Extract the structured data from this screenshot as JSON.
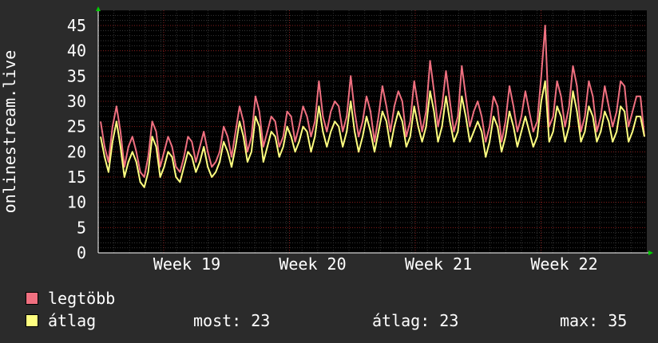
{
  "chart_data": {
    "type": "line",
    "ylabel": "onlinestream.live",
    "ylim": [
      0,
      48
    ],
    "yticks": [
      0,
      5,
      10,
      15,
      20,
      25,
      30,
      35,
      40,
      45
    ],
    "xticks": [
      "Week 19",
      "Week 20",
      "Week 21",
      "Week 22"
    ],
    "grid": true,
    "legend_placement": "bottom-left",
    "series": [
      {
        "name": "legtöbb",
        "color": "#f07080",
        "values": [
          26,
          21,
          18,
          25,
          29,
          24,
          17,
          21,
          23,
          20,
          16,
          15,
          19,
          26,
          24,
          17,
          20,
          23,
          21,
          17,
          16,
          19,
          23,
          22,
          18,
          21,
          24,
          20,
          17,
          18,
          20,
          25,
          23,
          19,
          24,
          29,
          26,
          20,
          23,
          31,
          28,
          21,
          24,
          27,
          26,
          21,
          23,
          28,
          27,
          22,
          25,
          29,
          27,
          23,
          26,
          34,
          27,
          24,
          28,
          30,
          29,
          24,
          27,
          35,
          28,
          23,
          26,
          31,
          28,
          22,
          27,
          33,
          29,
          24,
          29,
          32,
          30,
          23,
          26,
          34,
          29,
          24,
          28,
          38,
          32,
          25,
          29,
          36,
          30,
          24,
          27,
          37,
          31,
          25,
          28,
          30,
          27,
          22,
          25,
          31,
          29,
          22,
          26,
          33,
          29,
          24,
          27,
          32,
          28,
          24,
          26,
          35,
          45,
          25,
          27,
          34,
          31,
          25,
          29,
          37,
          33,
          24,
          27,
          34,
          31,
          24,
          27,
          33,
          29,
          25,
          28,
          34,
          33,
          25,
          28,
          31,
          31,
          23
        ]
      },
      {
        "name": "átlag",
        "color": "#ffff80",
        "values": [
          23,
          19,
          16,
          22,
          26,
          21,
          15,
          18,
          20,
          18,
          14,
          13,
          16,
          23,
          21,
          15,
          17,
          20,
          19,
          15,
          14,
          17,
          20,
          19,
          16,
          18,
          21,
          17,
          15,
          16,
          18,
          22,
          20,
          17,
          21,
          26,
          23,
          18,
          20,
          27,
          25,
          18,
          21,
          24,
          23,
          19,
          21,
          25,
          23,
          20,
          22,
          25,
          24,
          20,
          23,
          29,
          24,
          21,
          24,
          26,
          25,
          21,
          24,
          30,
          24,
          20,
          23,
          27,
          24,
          20,
          24,
          28,
          26,
          21,
          25,
          28,
          26,
          21,
          23,
          29,
          25,
          22,
          25,
          32,
          28,
          22,
          25,
          31,
          26,
          22,
          24,
          31,
          27,
          22,
          24,
          26,
          24,
          19,
          22,
          27,
          25,
          20,
          23,
          28,
          25,
          21,
          24,
          27,
          24,
          21,
          23,
          30,
          34,
          22,
          24,
          29,
          27,
          22,
          25,
          32,
          28,
          22,
          24,
          29,
          27,
          22,
          24,
          28,
          26,
          22,
          24,
          29,
          28,
          22,
          24,
          27,
          27,
          23
        ]
      }
    ]
  },
  "legend": [
    {
      "label": "legtöbb",
      "color": "#f07080"
    },
    {
      "label": "átlag",
      "color": "#ffff80"
    }
  ],
  "stats": {
    "most_label": "most:",
    "most_value": "23",
    "atlag_label": "átlag:",
    "atlag_value": "23",
    "max_label": "max:",
    "max_value": "35"
  }
}
